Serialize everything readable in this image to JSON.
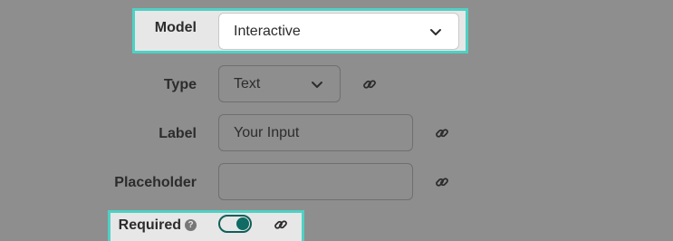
{
  "form": {
    "model": {
      "label": "Model",
      "value": "Interactive"
    },
    "type": {
      "label": "Type",
      "value": "Text"
    },
    "label_field": {
      "label": "Label",
      "value": "Your Input"
    },
    "placeholder_field": {
      "label": "Placeholder",
      "value": ""
    },
    "required": {
      "label": "Required",
      "help": "?",
      "on": true
    }
  },
  "colors": {
    "accent": "#0f6b63",
    "highlight": "#4fd1c5"
  },
  "icons": [
    "chevron-down-icon",
    "link-icon",
    "help-icon"
  ]
}
